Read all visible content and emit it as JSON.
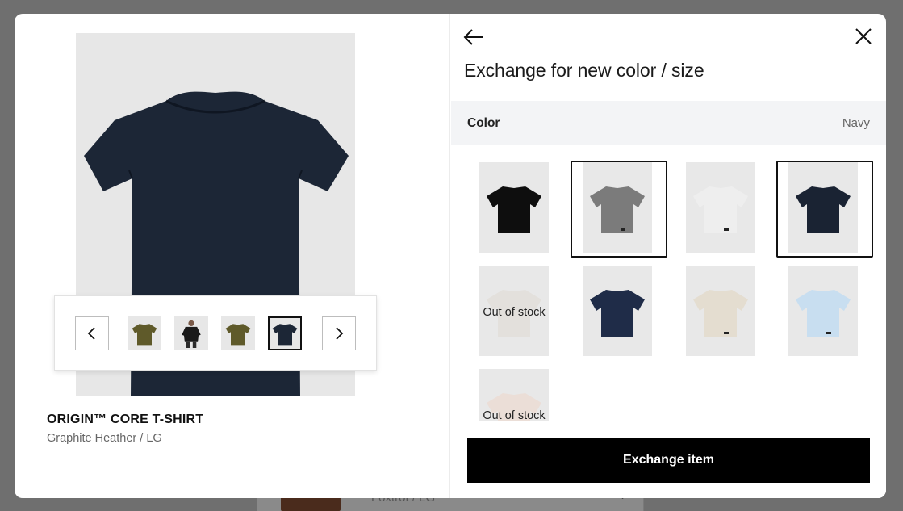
{
  "background": {
    "order_variant": "Foxtrot / LG"
  },
  "product": {
    "name": "ORIGIN™ CORE T-SHIRT",
    "variant": "Graphite Heather / LG"
  },
  "carousel": {
    "prev_icon": "chevron-left-icon",
    "next_icon": "chevron-right-icon",
    "thumbnails": [
      {
        "color": "#5f5a2a",
        "selected": false
      },
      {
        "color": "#1a1a1a",
        "selected": false
      },
      {
        "color": "#5f5a2a",
        "selected": false
      },
      {
        "color": "#1c2636",
        "selected": true
      }
    ]
  },
  "hero": {
    "shirt_color": "#1c2636"
  },
  "panel": {
    "back_icon": "arrow-left-icon",
    "close_icon": "close-icon",
    "title": "Exchange for new color / size",
    "color_label": "Color",
    "color_value": "Navy"
  },
  "swatches": [
    {
      "color": "#0e0e0e",
      "selected": false,
      "out_of_stock": false
    },
    {
      "color": "#7b7b7b",
      "selected": true,
      "out_of_stock": false
    },
    {
      "color": "#e9e9e9",
      "selected": false,
      "out_of_stock": false
    },
    {
      "color": "#1a2333",
      "selected": true,
      "out_of_stock": false
    },
    {
      "color": "#ddd8cf",
      "selected": false,
      "out_of_stock": true,
      "oos_label": "Out of stock"
    },
    {
      "color": "#1f2c48",
      "selected": false,
      "out_of_stock": false
    },
    {
      "color": "#e4ddd0",
      "selected": false,
      "out_of_stock": false
    },
    {
      "color": "#c8def0",
      "selected": false,
      "out_of_stock": false
    },
    {
      "color": "#efd3c4",
      "selected": false,
      "out_of_stock": true,
      "oos_label": "Out of stock"
    }
  ],
  "footer": {
    "exchange_label": "Exchange item"
  }
}
